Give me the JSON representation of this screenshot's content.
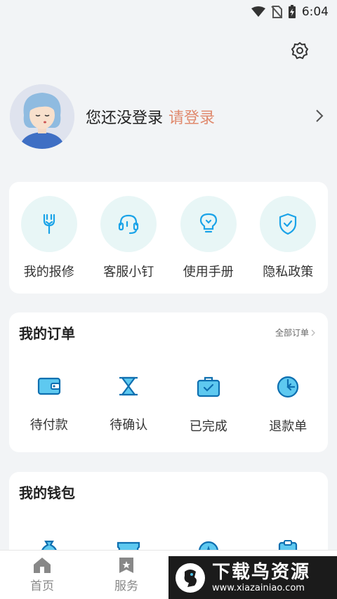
{
  "status_bar": {
    "time": "6:04"
  },
  "profile": {
    "status_text": "您还没登录",
    "login_link": "请登录"
  },
  "quick_actions": [
    {
      "label": "我的报修",
      "icon": "wrench-icon"
    },
    {
      "label": "客服小钉",
      "icon": "headset-icon"
    },
    {
      "label": "使用手册",
      "icon": "lightbulb-icon"
    },
    {
      "label": "隐私政策",
      "icon": "shield-icon"
    }
  ],
  "orders": {
    "title": "我的订单",
    "more": "全部订单",
    "items": [
      {
        "label": "待付款",
        "icon": "wallet-icon"
      },
      {
        "label": "待确认",
        "icon": "hourglass-icon"
      },
      {
        "label": "已完成",
        "icon": "briefcase-icon"
      },
      {
        "label": "退款单",
        "icon": "refund-icon"
      }
    ]
  },
  "wallet": {
    "title": "我的钱包"
  },
  "tabbar": {
    "items": [
      {
        "label": "首页",
        "icon": "home-icon"
      },
      {
        "label": "服务",
        "icon": "service-icon"
      }
    ]
  },
  "watermark": {
    "title": "下载鸟资源",
    "url": "www.xiazainiao.com"
  },
  "colors": {
    "accent": "#1aa3e8",
    "login_link": "#e08a6e",
    "icon_bg": "#e8f6f6"
  }
}
